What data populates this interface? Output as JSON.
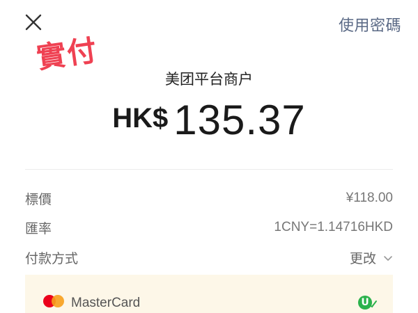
{
  "header": {
    "close_icon": "close-icon",
    "password_link": "使用密碼"
  },
  "stamp": {
    "text": "實付",
    "color": "#ef4152"
  },
  "payment": {
    "merchant": "美团平台商户",
    "currency": "HK$",
    "amount": "135.37"
  },
  "details": [
    {
      "label": "標價",
      "value": "¥118.00"
    },
    {
      "label": "匯率",
      "value": "1CNY=1.14716HKD"
    }
  ],
  "method": {
    "label": "付款方式",
    "action": "更改",
    "action_icon": "chevron-down-icon"
  },
  "card": {
    "name": "MasterCard",
    "icon": "mastercard-logo",
    "panel_color": "#fdf7e8"
  },
  "watermark": {
    "letter": "U",
    "color": "#2bb24c"
  }
}
